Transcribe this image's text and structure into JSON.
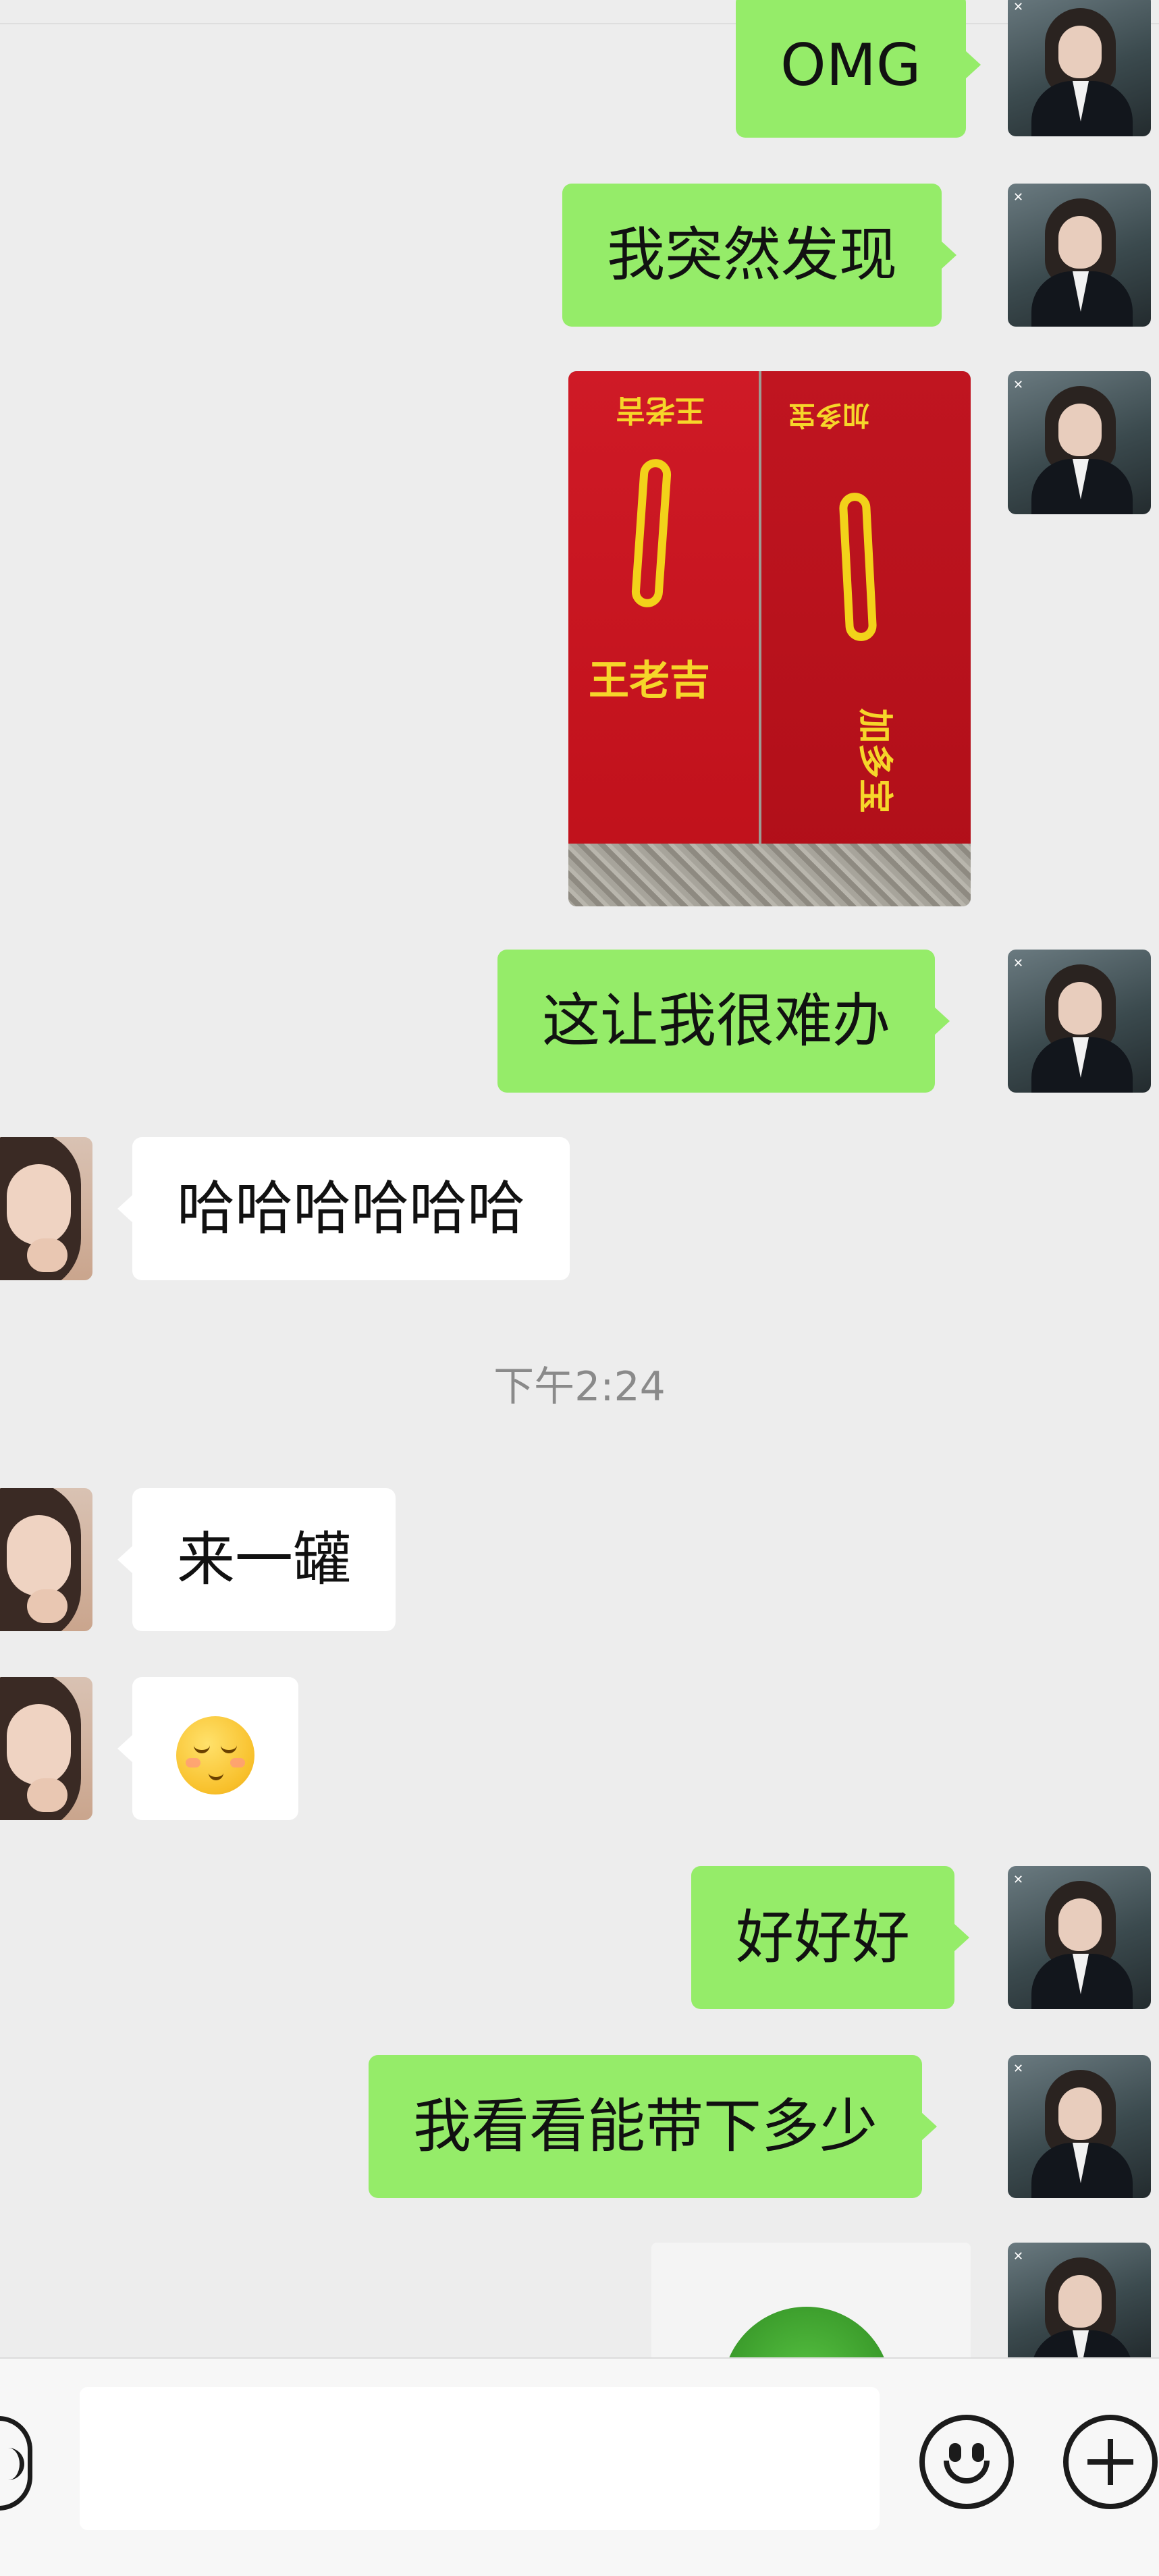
{
  "messages": {
    "m1": "OMG",
    "m2": "我突然发现",
    "m3_image": {
      "box_left_brand": "王老吉",
      "box_left_brand_top": "王老吉",
      "box_right_brand": "加多宝",
      "box_right_brand_top": "加多宝"
    },
    "m4": "这让我很难办",
    "m5": "哈哈哈哈哈哈",
    "m6": "来一罐",
    "m7_emoji": "😌",
    "m8": "好好好",
    "m9": "我看看能带下多少"
  },
  "timestamp": "下午2:24",
  "input": {
    "placeholder": ""
  },
  "colors": {
    "bubble_me": "#95ec69",
    "bubble_other": "#ffffff",
    "background": "#ededed"
  },
  "icons": [
    "voice-icon",
    "emoji-icon",
    "plus-icon"
  ]
}
